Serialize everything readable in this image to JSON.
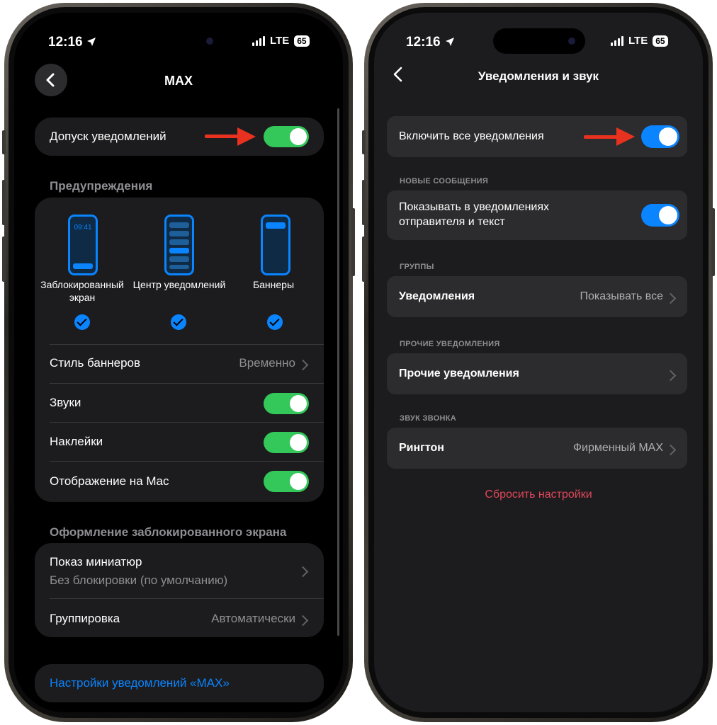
{
  "left": {
    "status": {
      "time": "12:16",
      "network": "LTE",
      "battery": "65"
    },
    "nav": {
      "title": "MAX"
    },
    "allow_notifications": {
      "label": "Допуск уведомлений",
      "enabled": true
    },
    "alerts": {
      "title": "Предупреждения",
      "options": [
        {
          "label": "Заблокированный экран",
          "preview_time": "09:41",
          "checked": true
        },
        {
          "label": "Центр уведомлений",
          "checked": true
        },
        {
          "label": "Баннеры",
          "checked": true
        }
      ],
      "banner_style": {
        "label": "Стиль баннеров",
        "value": "Временно"
      },
      "sounds": {
        "label": "Звуки",
        "enabled": true
      },
      "badges": {
        "label": "Наклейки",
        "enabled": true
      },
      "show_on_mac": {
        "label": "Отображение на Mac",
        "enabled": true
      }
    },
    "lock_screen": {
      "title": "Оформление заблокированного экрана",
      "show_previews": {
        "label": "Показ миниатюр",
        "value": "Без блокировки (по умолчанию)"
      },
      "grouping": {
        "label": "Группировка",
        "value": "Автоматически"
      }
    },
    "app_settings_link": "Настройки уведомлений «MAX»"
  },
  "right": {
    "status": {
      "time": "12:16",
      "network": "LTE",
      "battery": "65"
    },
    "nav": {
      "title": "Уведомления и звук"
    },
    "enable_all": {
      "label": "Включить все уведомления",
      "enabled": true
    },
    "new_messages": {
      "section": "НОВЫЕ СООБЩЕНИЯ",
      "show_sender_line1": "Показывать в уведомлениях",
      "show_sender_line2": "отправителя и текст",
      "enabled": true
    },
    "groups": {
      "section": "ГРУППЫ",
      "label": "Уведомления",
      "value": "Показывать все"
    },
    "other": {
      "section": "ПРОЧИЕ УВЕДОМЛЕНИЯ",
      "label": "Прочие уведомления"
    },
    "ringtone": {
      "section": "ЗВУК ЗВОНКА",
      "label": "Рингтон",
      "value": "Фирменный MAX"
    },
    "reset": "Сбросить настройки"
  },
  "colors": {
    "toggle_green": "#34c759",
    "toggle_blue": "#0a84ff",
    "arrow": "#e8321f",
    "reset": "#e0475a",
    "link": "#0a84ff"
  }
}
